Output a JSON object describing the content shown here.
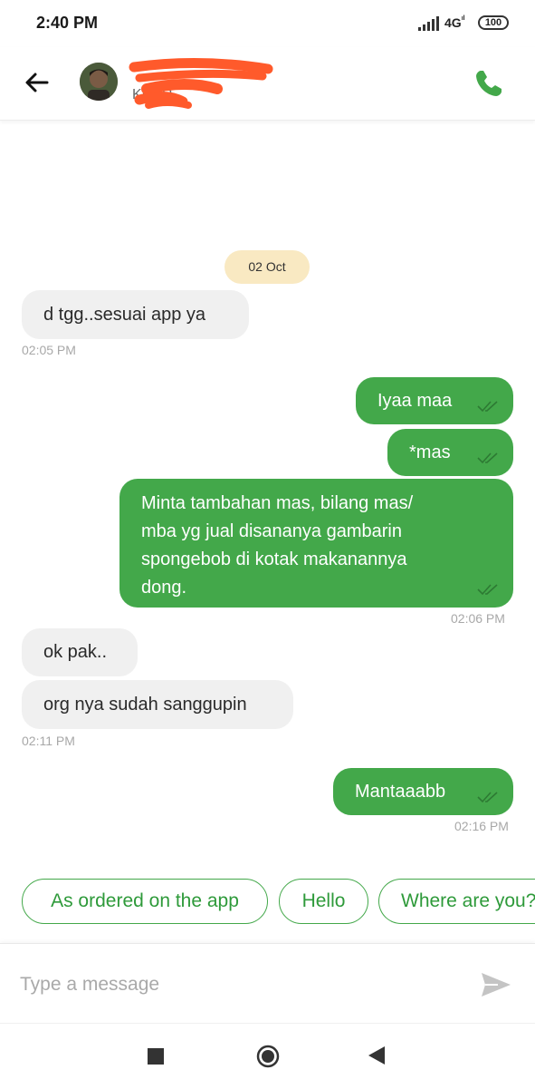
{
  "status_bar": {
    "time": "2:40 PM",
    "network": "4G",
    "battery": "100"
  },
  "header": {
    "contact_name": "",
    "contact_sub": "KFOR"
  },
  "chat": {
    "date_chip": "02 Oct",
    "messages": [
      {
        "text": "d tgg..sesuai app ya"
      },
      {
        "time": "02:05 PM"
      },
      {
        "text": "Iyaa maa"
      },
      {
        "text": "*mas"
      },
      {
        "line1": "Minta tambahan mas, bilang mas/",
        "line2": "mba yg jual disananya gambarin",
        "line3": "spongebob di kotak makanannya",
        "line4": "dong.",
        "time": "02:06 PM"
      },
      {
        "text": "ok pak.."
      },
      {
        "text": "org nya sudah sanggupin",
        "time": "02:11 PM"
      },
      {
        "text": "Mantaaabb",
        "time": "02:16 PM"
      }
    ]
  },
  "quick_replies": [
    "As ordered on the app",
    "Hello",
    "Where are you?"
  ],
  "composer": {
    "placeholder": "Type a message",
    "value": ""
  },
  "colors": {
    "accent": "#43a84a",
    "incoming": "#f0f0f0",
    "date_chip": "#f9e9c2",
    "redaction": "#ff5a2b"
  },
  "icons": [
    "back-arrow-icon",
    "phone-icon",
    "double-check-icon",
    "send-icon",
    "nav-square-icon",
    "nav-home-icon",
    "nav-back-icon"
  ]
}
